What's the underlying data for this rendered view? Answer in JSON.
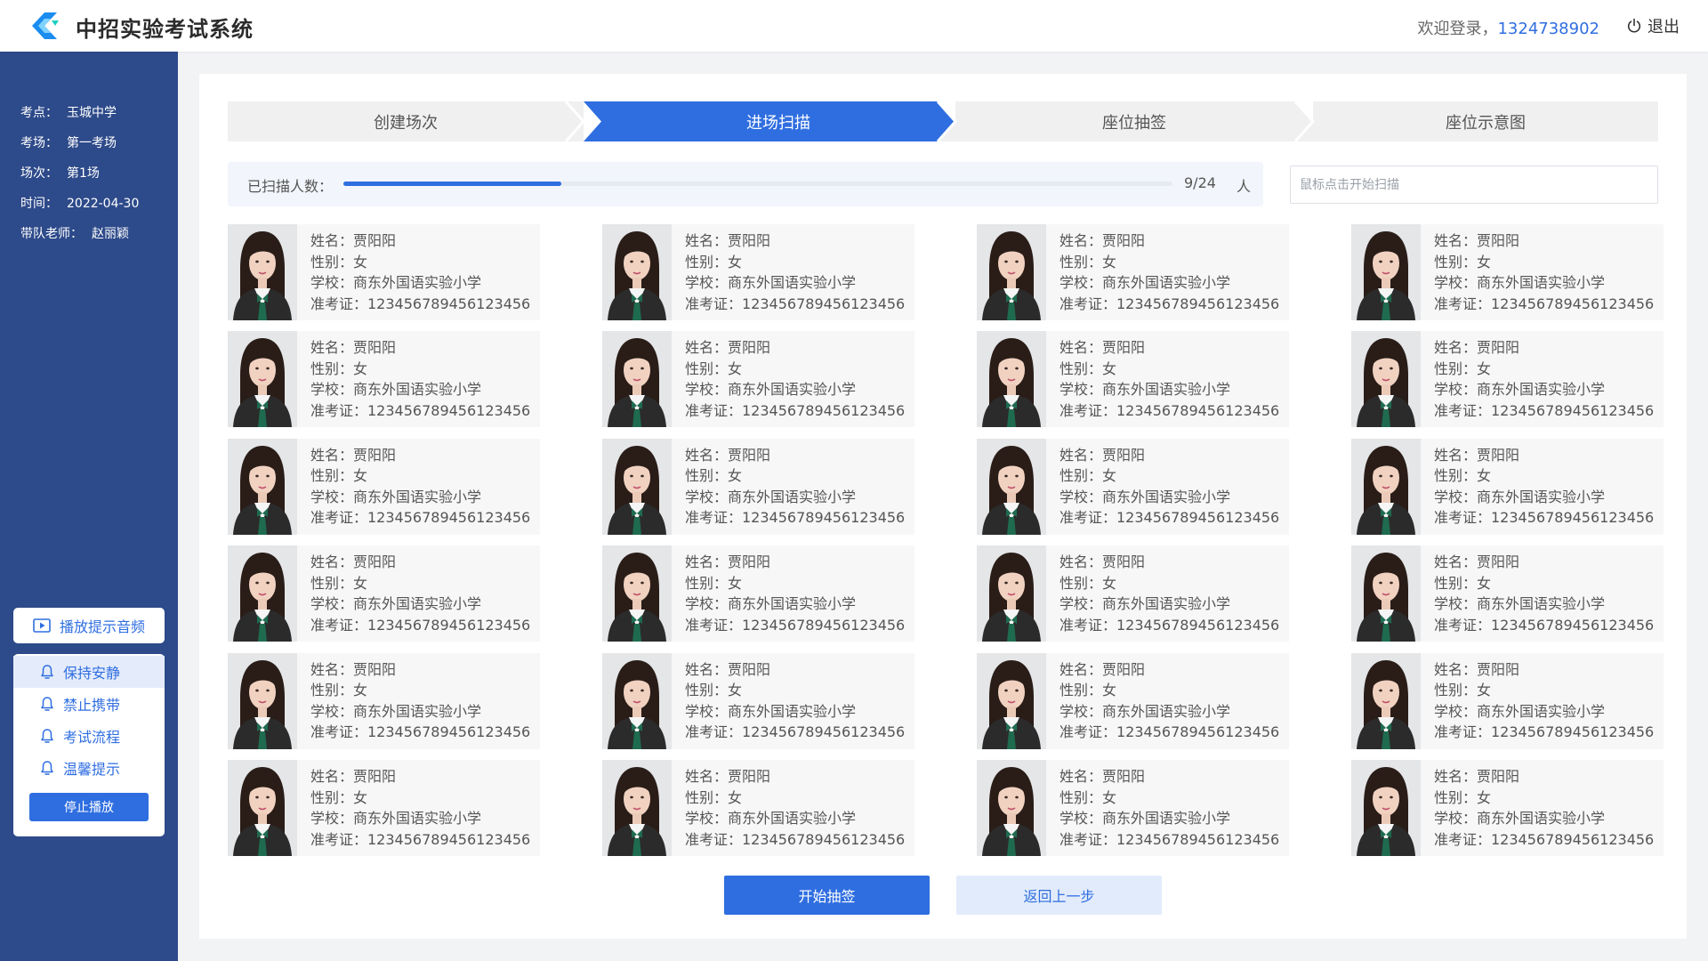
{
  "app": {
    "title": "中招实验考试系统",
    "welcome_prefix": "欢迎登录，",
    "username": "1324738902",
    "logout_label": "退出"
  },
  "sidebar": {
    "info": [
      {
        "key": "考点：",
        "value": "玉城中学"
      },
      {
        "key": "考场：",
        "value": "第一考场"
      },
      {
        "key": "场次：",
        "value": "第1场"
      },
      {
        "key": "时间：",
        "value": "2022-04-30"
      },
      {
        "key": "带队老师：",
        "value": "赵丽颖"
      }
    ],
    "audio_button_label": "播放提示音频",
    "audio_items": [
      {
        "label": "保持安静",
        "active": true
      },
      {
        "label": "禁止携带",
        "active": false
      },
      {
        "label": "考试流程",
        "active": false
      },
      {
        "label": "温馨提示",
        "active": false
      }
    ],
    "stop_label": "停止播放"
  },
  "steps": [
    {
      "label": "创建场次",
      "active": false
    },
    {
      "label": "进场扫描",
      "active": true
    },
    {
      "label": "座位抽签",
      "active": false
    },
    {
      "label": "座位示意图",
      "active": false
    }
  ],
  "progress": {
    "label": "已扫描人数：",
    "scanned": 9,
    "total": 24,
    "count_text": "9/24",
    "unit": "人"
  },
  "scan_input": {
    "placeholder": "鼠标点击开始扫描",
    "value": ""
  },
  "students": [
    {
      "name_line": "姓名：贾阳阳",
      "gender_line": "性别：女",
      "school_line": "学校：商东外国语实验小学",
      "ticket_line": "准考证：123456789456123456"
    },
    {
      "name_line": "姓名：贾阳阳",
      "gender_line": "性别：女",
      "school_line": "学校：商东外国语实验小学",
      "ticket_line": "准考证：123456789456123456"
    },
    {
      "name_line": "姓名：贾阳阳",
      "gender_line": "性别：女",
      "school_line": "学校：商东外国语实验小学",
      "ticket_line": "准考证：123456789456123456"
    },
    {
      "name_line": "姓名：贾阳阳",
      "gender_line": "性别：女",
      "school_line": "学校：商东外国语实验小学",
      "ticket_line": "准考证：123456789456123456"
    },
    {
      "name_line": "姓名：贾阳阳",
      "gender_line": "性别：女",
      "school_line": "学校：商东外国语实验小学",
      "ticket_line": "准考证：123456789456123456"
    },
    {
      "name_line": "姓名：贾阳阳",
      "gender_line": "性别：女",
      "school_line": "学校：商东外国语实验小学",
      "ticket_line": "准考证：123456789456123456"
    },
    {
      "name_line": "姓名：贾阳阳",
      "gender_line": "性别：女",
      "school_line": "学校：商东外国语实验小学",
      "ticket_line": "准考证：123456789456123456"
    },
    {
      "name_line": "姓名：贾阳阳",
      "gender_line": "性别：女",
      "school_line": "学校：商东外国语实验小学",
      "ticket_line": "准考证：123456789456123456"
    },
    {
      "name_line": "姓名：贾阳阳",
      "gender_line": "性别：女",
      "school_line": "学校：商东外国语实验小学",
      "ticket_line": "准考证：123456789456123456"
    },
    {
      "name_line": "姓名：贾阳阳",
      "gender_line": "性别：女",
      "school_line": "学校：商东外国语实验小学",
      "ticket_line": "准考证：123456789456123456"
    },
    {
      "name_line": "姓名：贾阳阳",
      "gender_line": "性别：女",
      "school_line": "学校：商东外国语实验小学",
      "ticket_line": "准考证：123456789456123456"
    },
    {
      "name_line": "姓名：贾阳阳",
      "gender_line": "性别：女",
      "school_line": "学校：商东外国语实验小学",
      "ticket_line": "准考证：123456789456123456"
    },
    {
      "name_line": "姓名：贾阳阳",
      "gender_line": "性别：女",
      "school_line": "学校：商东外国语实验小学",
      "ticket_line": "准考证：123456789456123456"
    },
    {
      "name_line": "姓名：贾阳阳",
      "gender_line": "性别：女",
      "school_line": "学校：商东外国语实验小学",
      "ticket_line": "准考证：123456789456123456"
    },
    {
      "name_line": "姓名：贾阳阳",
      "gender_line": "性别：女",
      "school_line": "学校：商东外国语实验小学",
      "ticket_line": "准考证：123456789456123456"
    },
    {
      "name_line": "姓名：贾阳阳",
      "gender_line": "性别：女",
      "school_line": "学校：商东外国语实验小学",
      "ticket_line": "准考证：123456789456123456"
    },
    {
      "name_line": "姓名：贾阳阳",
      "gender_line": "性别：女",
      "school_line": "学校：商东外国语实验小学",
      "ticket_line": "准考证：123456789456123456"
    },
    {
      "name_line": "姓名：贾阳阳",
      "gender_line": "性别：女",
      "school_line": "学校：商东外国语实验小学",
      "ticket_line": "准考证：123456789456123456"
    },
    {
      "name_line": "姓名：贾阳阳",
      "gender_line": "性别：女",
      "school_line": "学校：商东外国语实验小学",
      "ticket_line": "准考证：123456789456123456"
    },
    {
      "name_line": "姓名：贾阳阳",
      "gender_line": "性别：女",
      "school_line": "学校：商东外国语实验小学",
      "ticket_line": "准考证：123456789456123456"
    },
    {
      "name_line": "姓名：贾阳阳",
      "gender_line": "性别：女",
      "school_line": "学校：商东外国语实验小学",
      "ticket_line": "准考证：123456789456123456"
    },
    {
      "name_line": "姓名：贾阳阳",
      "gender_line": "性别：女",
      "school_line": "学校：商东外国语实验小学",
      "ticket_line": "准考证：123456789456123456"
    },
    {
      "name_line": "姓名：贾阳阳",
      "gender_line": "性别：女",
      "school_line": "学校：商东外国语实验小学",
      "ticket_line": "准考证：123456789456123456"
    },
    {
      "name_line": "姓名：贾阳阳",
      "gender_line": "性别：女",
      "school_line": "学校：商东外国语实验小学",
      "ticket_line": "准考证：123456789456123456"
    }
  ],
  "actions": {
    "start_draw_label": "开始抽签",
    "back_label": "返回上一步"
  },
  "colors": {
    "primary": "#2f6ee0",
    "sidebar_bg": "#2d4a8a",
    "light_blue": "#e2ebfb"
  }
}
